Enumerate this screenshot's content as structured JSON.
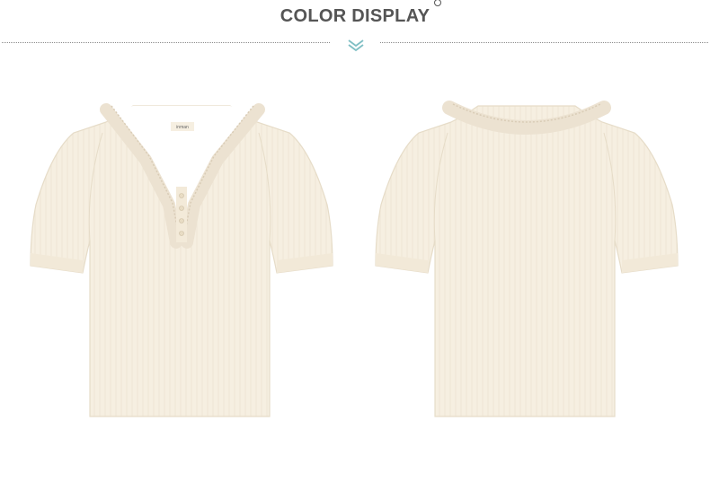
{
  "header": {
    "title": "COLOR DISPLAY"
  },
  "colors": {
    "title": "#555555",
    "fabric": "#f6efe1",
    "lace": "#ece2d1",
    "accent": "#7fbfc4"
  },
  "products": [
    {
      "view": "front",
      "label_text": "inman"
    },
    {
      "view": "back"
    }
  ]
}
